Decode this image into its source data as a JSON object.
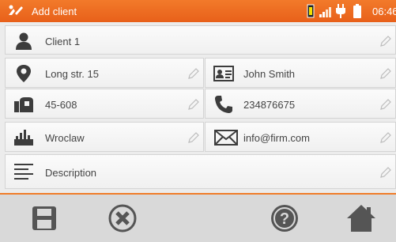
{
  "header": {
    "title": "Add client",
    "time": "06:46",
    "icons": [
      "logo-icon",
      "battery-level-icon",
      "signal-icon",
      "plug-icon",
      "battery-icon"
    ],
    "accent": "#f07d2a"
  },
  "client": {
    "name": "Client 1",
    "address": "Long str. 15",
    "contact": "John Smith",
    "postal_code": "45-608",
    "phone": "234876675",
    "city": "Wroclaw",
    "email": "info@firm.com",
    "description": "Description"
  },
  "footer": {
    "buttons": [
      "save-icon",
      "cancel-icon",
      "help-icon",
      "home-icon"
    ]
  }
}
